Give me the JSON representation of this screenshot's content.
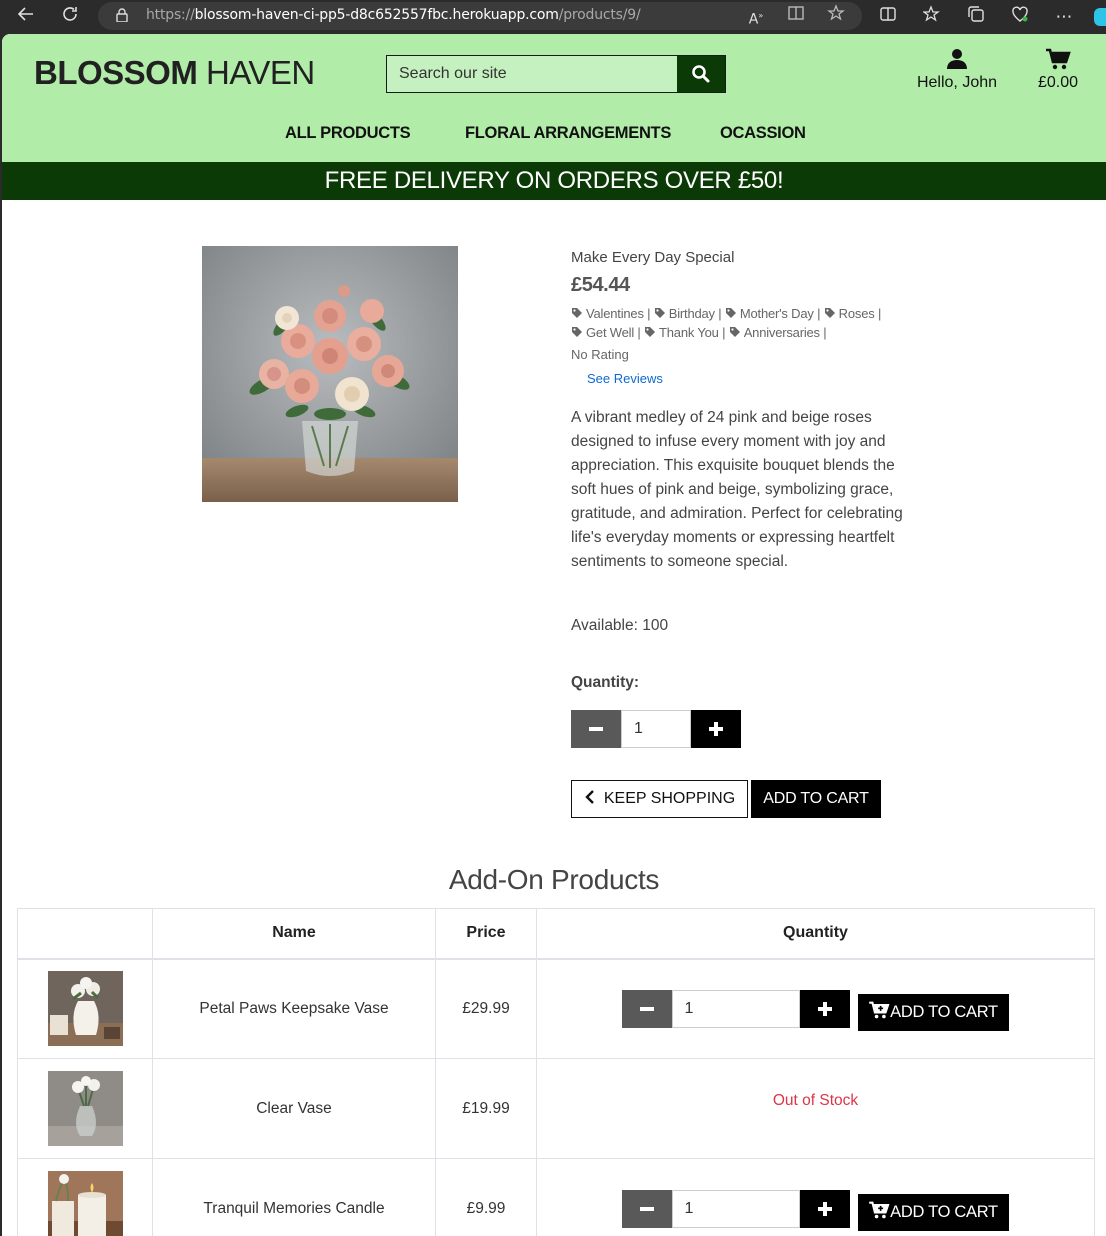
{
  "browser": {
    "url_scheme": "https://",
    "url_host": "blossom-haven-ci-pp5-d8c652557fbc.herokuapp.com",
    "url_path": "/products/9/"
  },
  "header": {
    "logo_bold": "BLOSSOM",
    "logo_light": " HAVEN",
    "search_placeholder": "Search our site",
    "account_label": "Hello, John",
    "cart_total": "£0.00",
    "nav": [
      "ALL PRODUCTS",
      "FLORAL ARRANGEMENTS",
      "OCASSION"
    ]
  },
  "banner": "FREE DELIVERY ON ORDERS OVER £50!",
  "product": {
    "name": "Make Every Day Special",
    "price": "£54.44",
    "tags": [
      "Valentines",
      "Birthday",
      "Mother's Day",
      "Roses",
      "Get Well",
      "Thank You",
      "Anniversaries"
    ],
    "rating": "No Rating",
    "reviews_link": "See Reviews",
    "description": "A vibrant medley of 24 pink and beige roses designed to infuse every moment with joy and appreciation. This exquisite bouquet blends the soft hues of pink and beige, symbolizing grace, gratitude, and admiration. Perfect for celebrating life's everyday moments or expressing heartfelt sentiments to someone special.",
    "available": "Available: 100",
    "quantity_label": "Quantity:",
    "quantity_value": "1",
    "keep_shopping": "KEEP SHOPPING",
    "add_to_cart": "ADD TO CART"
  },
  "addons": {
    "title": "Add-On Products",
    "columns": [
      "",
      "Name",
      "Price",
      "Quantity"
    ],
    "rows": [
      {
        "name": "Petal Paws Keepsake Vase",
        "price": "£29.99",
        "quantity": "1",
        "action": "ADD TO CART",
        "in_stock": true
      },
      {
        "name": "Clear Vase",
        "price": "£19.99",
        "status": "Out of Stock",
        "in_stock": false
      },
      {
        "name": "Tranquil Memories Candle",
        "price": "£9.99",
        "quantity": "1",
        "action": "ADD TO CART",
        "in_stock": true
      }
    ]
  },
  "colors": {
    "header_bg": "#b2eca9",
    "banner_bg": "#0b3a07",
    "link": "#0c6ad1",
    "out_of_stock": "#dc3545"
  }
}
